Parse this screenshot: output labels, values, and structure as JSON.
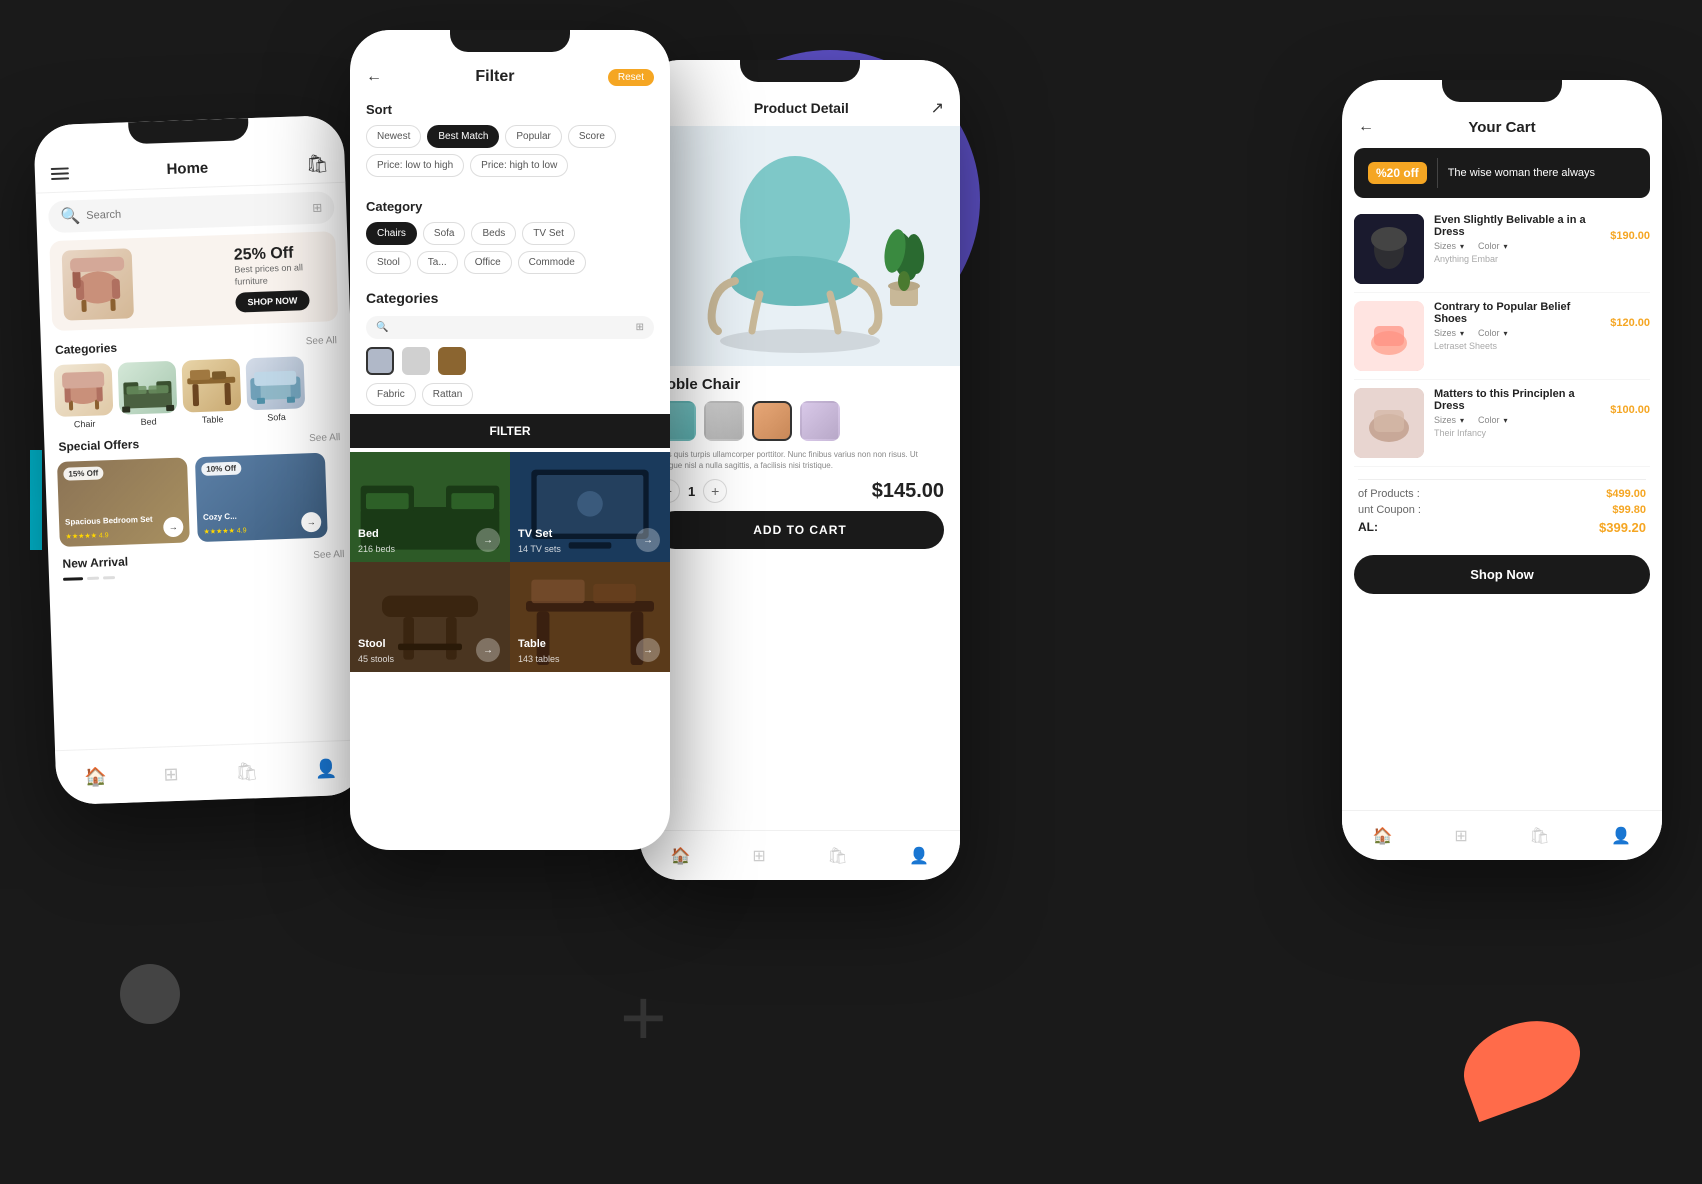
{
  "background": {
    "colors": {
      "main": "#1a1a1a",
      "purple": "#6B5CE7",
      "yellow": "#F5C518",
      "teal": "#00BCD4",
      "coral": "#FF6B4A"
    }
  },
  "phone1": {
    "header": {
      "title": "Home",
      "cart_icon": "🛍"
    },
    "search": {
      "placeholder": "Search"
    },
    "banner": {
      "discount": "25% Off",
      "subtitle": "Best prices on all furniture",
      "cta": "SHOP NOW"
    },
    "categories_title": "Categories",
    "see_all": "See All",
    "categories": [
      {
        "label": "Chair"
      },
      {
        "label": "Bed"
      },
      {
        "label": "Table"
      },
      {
        "label": "Sofa"
      }
    ],
    "special_offers_title": "Special Offers",
    "offers": [
      {
        "badge": "15% Off",
        "title": "Spacious Bedroom Set",
        "rating": "★★★★★",
        "score": "4.9"
      },
      {
        "badge": "10% Off",
        "title": "Cozy C...",
        "rating": "★★★★★",
        "score": "4.9"
      }
    ],
    "new_arrival_title": "New Arrival",
    "nav": [
      "🏠",
      "⊞",
      "🛍",
      "👤"
    ]
  },
  "phone2": {
    "header": {
      "title": "Filter",
      "back": "←",
      "reset": "Reset"
    },
    "sort": {
      "title": "Sort",
      "options": [
        "Newest",
        "Best Match",
        "Popular",
        "Score"
      ],
      "active": "Best Match",
      "price_options": [
        "Price: low to high",
        "Price: high to low"
      ]
    },
    "category": {
      "title": "Category",
      "options": [
        "Chairs",
        "Sofa",
        "Beds",
        "TV Set",
        "Stool",
        "Ta...",
        "Office",
        "Commode"
      ],
      "active": "Chairs"
    },
    "categories_title": "Categories",
    "colors": [
      "#b0b8c8",
      "#d0d0d0",
      "#8B6530"
    ],
    "materials": [
      "Fabric",
      "Rattan"
    ],
    "filter_btn": "FILTER",
    "grid": [
      {
        "name": "Bed",
        "count": "216 beds"
      },
      {
        "name": "TV Set",
        "count": "14 TV sets"
      },
      {
        "name": "Stool",
        "count": "45 stools"
      },
      {
        "name": "Table",
        "count": "143 tables"
      }
    ]
  },
  "phone3": {
    "header": {
      "title": "Product Detail",
      "share": "↗"
    },
    "product": {
      "name": "Noble Chair",
      "aspect": "4:9",
      "description": "eros quis turpis ullamcorper porttitor. Nunc finibus varius non non risus. Ut congue nisl a nulla sagittis, a facilisis nisi tristique.",
      "quantity": "1",
      "price": "$145.00",
      "add_to_cart": "ADD TO CART"
    },
    "color_options": [
      {
        "type": "teal",
        "selected": false
      },
      {
        "type": "gray",
        "selected": false
      },
      {
        "type": "orange",
        "selected": true
      },
      {
        "type": "lavender",
        "selected": false
      }
    ],
    "nav": [
      "🏠",
      "⊞",
      "🛍",
      "👤"
    ]
  },
  "phone4": {
    "header": {
      "title": "Your Cart",
      "back": "←"
    },
    "promo": {
      "badge": "%20 off",
      "text": "The wise woman there always"
    },
    "items": [
      {
        "name": "Even Slightly Belivable a in a Dress",
        "sizes_label": "Sizes",
        "color_label": "Color",
        "subtext": "Anything Embar",
        "price": "$190.00"
      },
      {
        "name": "Contrary to Popular Belief Shoes",
        "sizes_label": "Sizes",
        "color_label": "Color",
        "subtext": "Letraset Sheets",
        "price": "$120.00"
      },
      {
        "name": "Matters to this Principlen a Dress",
        "sizes_label": "Sizes",
        "color_label": "Color",
        "subtext": "Their Infancy",
        "price": "$100.00"
      }
    ],
    "summary": {
      "products_label": "of Products :",
      "products_value": "$499.00",
      "coupon_label": "unt Coupon :",
      "coupon_value": "$99.80",
      "total_label": "AL:",
      "total_value": "$399.20"
    },
    "shop_now": "Shop Now",
    "nav": [
      "🏠",
      "⊞",
      "🛍",
      "👤"
    ]
  }
}
